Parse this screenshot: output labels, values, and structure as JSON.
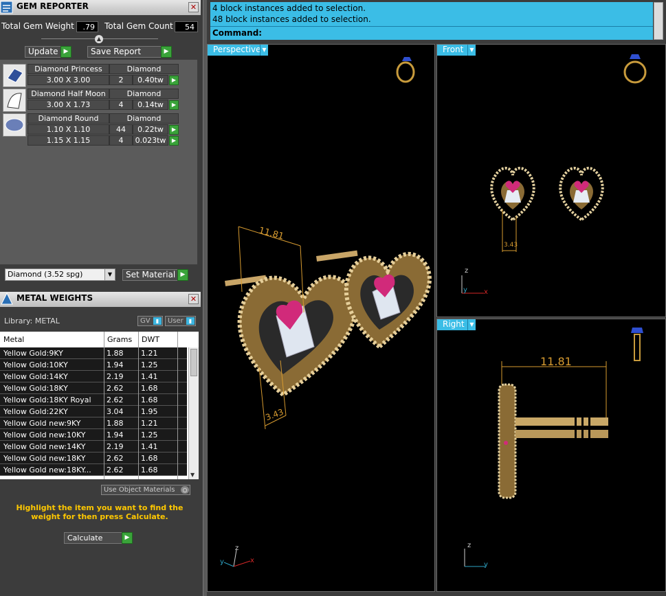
{
  "gem_reporter": {
    "title": "GEM REPORTER",
    "total_weight_label": "Total Gem Weight",
    "total_weight_value": ".79",
    "total_count_label": "Total Gem Count",
    "total_count_value": "54",
    "update_label": "Update",
    "save_report_label": "Save Report",
    "gems": [
      {
        "name": "Diamond Princess",
        "material": "Diamond",
        "rows": [
          {
            "size": "3.00 X 3.00",
            "count": "2",
            "weight": "0.40tw"
          }
        ]
      },
      {
        "name": "Diamond Half Moon",
        "material": "Diamond",
        "rows": [
          {
            "size": "3.00 X 1.73",
            "count": "4",
            "weight": "0.14tw"
          }
        ]
      },
      {
        "name": "Diamond Round",
        "material": "Diamond",
        "rows": [
          {
            "size": "1.10 X 1.10",
            "count": "44",
            "weight": "0.22tw"
          },
          {
            "size": "1.15 X 1.15",
            "count": "4",
            "weight": "0.023tw"
          }
        ]
      }
    ],
    "material_select": "Diamond     (3.52 spg)",
    "set_material_label": "Set Material"
  },
  "metal_weights": {
    "title": "METAL WEIGHTS",
    "library_label": "Library: METAL",
    "gv_label": "GV",
    "user_label": "User",
    "columns": [
      "Metal",
      "Grams",
      "DWT"
    ],
    "rows": [
      [
        "Yellow Gold:9KY",
        "1.88",
        "1.21"
      ],
      [
        "Yellow Gold:10KY",
        "1.94",
        "1.25"
      ],
      [
        "Yellow Gold:14KY",
        "2.19",
        "1.41"
      ],
      [
        "Yellow Gold:18KY",
        "2.62",
        "1.68"
      ],
      [
        "Yellow Gold:18KY Royal",
        "2.62",
        "1.68"
      ],
      [
        "Yellow Gold:22KY",
        "3.04",
        "1.95"
      ],
      [
        "Yellow Gold new:9KY",
        "1.88",
        "1.21"
      ],
      [
        "Yellow Gold new:10KY",
        "1.94",
        "1.25"
      ],
      [
        "Yellow Gold new:14KY",
        "2.19",
        "1.41"
      ],
      [
        "Yellow Gold new:18KY",
        "2.62",
        "1.68"
      ],
      [
        "Yellow Gold new:18KY...",
        "2.62",
        "1.68"
      ]
    ],
    "use_object_materials_label": "Use Object Materials",
    "hint": "Highlight the item you want to find the weight for then press Calculate.",
    "calculate_label": "Calculate"
  },
  "command": {
    "line1": "4 block instances added to selection.",
    "line2": "48 block instances added to selection.",
    "prompt": "Command:"
  },
  "viewports": {
    "perspective": "Perspective",
    "front": "Front",
    "right": "Right",
    "dim_large": "11.81",
    "dim_small": "3.43"
  },
  "axes": {
    "x": "x",
    "y": "y",
    "z": "z"
  }
}
